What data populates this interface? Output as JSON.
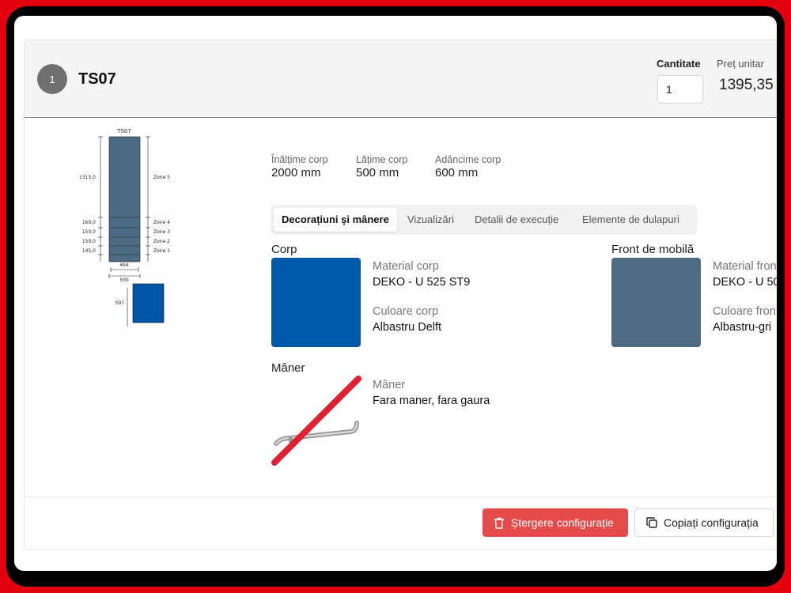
{
  "item": {
    "index": "1",
    "name": "TS07",
    "quantity_label": "Cantitate",
    "quantity_value": "1",
    "price_label": "Preț unitar",
    "price_value": "1395,35"
  },
  "drawing": {
    "title": "TS07",
    "zones": [
      "Zone 5",
      "Zone 4",
      "Zone 3",
      "Zone 2",
      "Zone 1"
    ],
    "zone_heights": [
      "1315,0",
      "160,0",
      "150,0",
      "150,0",
      "145,0"
    ],
    "inner_width": "464",
    "outer_width": "500",
    "depth": "597",
    "colors": {
      "body": "#4b6b85",
      "front": "#0057a8"
    }
  },
  "dimensions": [
    {
      "label": "Înălțime corp",
      "value": "2000 mm"
    },
    {
      "label": "Lățime corp",
      "value": "500 mm"
    },
    {
      "label": "Adâncime corp",
      "value": "600 mm"
    }
  ],
  "tabs": [
    "Decorațiuni și mânere",
    "Vizualizări",
    "Detalii de execuție",
    "Elemente de dulapuri"
  ],
  "corp": {
    "title": "Corp",
    "swatch_color": "#0058a8",
    "material_label": "Material corp",
    "material_value": "DEKO - U 525 ST9",
    "color_label": "Culoare corp",
    "color_value": "Albastru Delft"
  },
  "front": {
    "title": "Front de mobilă",
    "swatch_color": "#4f6b84",
    "material_label": "Material fron",
    "material_value": "DEKO - U 50",
    "color_label": "Culoare fron",
    "color_value": "Albastru-gri"
  },
  "handle": {
    "title": "Mâner",
    "label": "Mâner",
    "value": "Fara maner, fara gaura"
  },
  "actions": {
    "delete": "Ștergere configurație",
    "copy": "Copiați configurația"
  }
}
